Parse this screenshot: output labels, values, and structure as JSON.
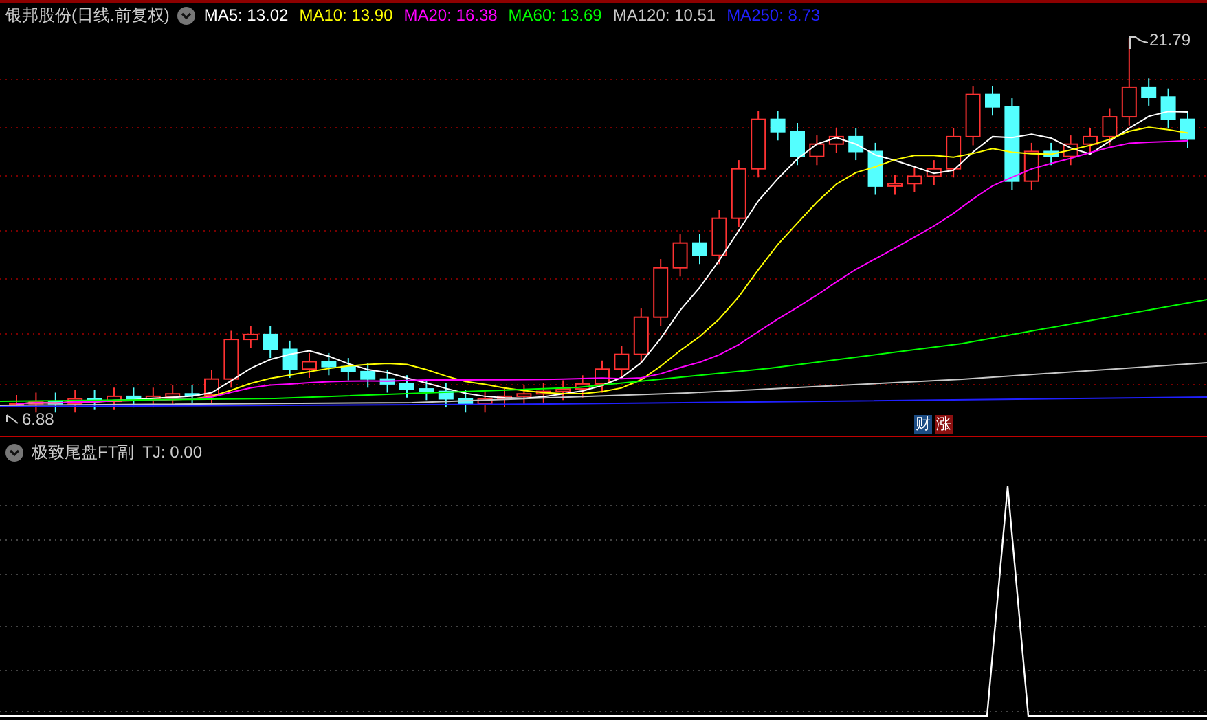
{
  "price_panel": {
    "title": "银邦股份(日线.前复权)",
    "ma_legend": [
      {
        "label": "MA5: 13.02",
        "color": "#ffffff"
      },
      {
        "label": "MA10: 13.90",
        "color": "#ffff00"
      },
      {
        "label": "MA20: 16.38",
        "color": "#ff00ff"
      },
      {
        "label": "MA60: 13.69",
        "color": "#00ff00"
      },
      {
        "label": "MA120: 10.51",
        "color": "#c8c8c8"
      },
      {
        "label": "MA250: 8.73",
        "color": "#2020ff"
      }
    ],
    "high_label": "21.79",
    "low_label": "6.88",
    "badges": [
      {
        "text": "财",
        "color": "#1c4c84"
      },
      {
        "text": "涨",
        "color": "#8c1010"
      }
    ]
  },
  "indicator_panel": {
    "title": "极致尾盘FT副",
    "reading": "TJ: 0.00"
  }
}
